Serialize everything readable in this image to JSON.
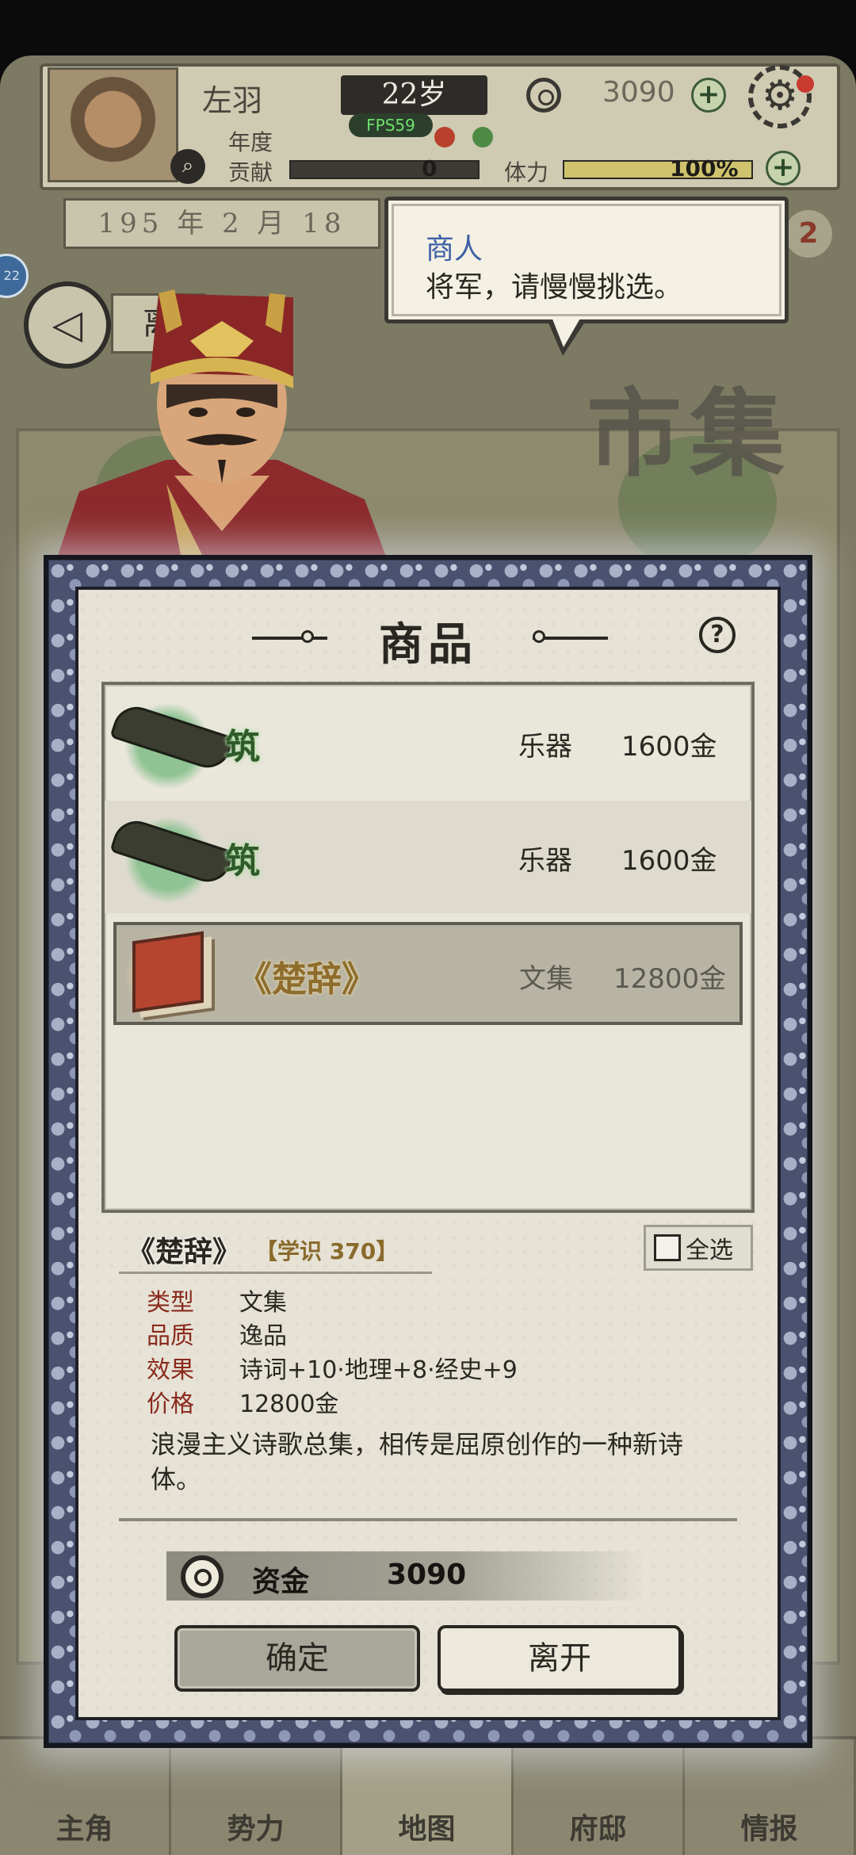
{
  "hud": {
    "name": "左羽",
    "age": "22岁",
    "fps": "FPS59",
    "money": "3090",
    "label_year": "年度",
    "label_contrib": "贡献",
    "contrib_value": "0",
    "label_stamina": "体力",
    "stamina_value": "100%",
    "stamina_fraction": 1.0,
    "date": "195 年 2 月 18",
    "back_label": "离",
    "left_bubble": "22",
    "right_badge": "2"
  },
  "scene": {
    "sign_text": "市集"
  },
  "speech": {
    "speaker": "商人",
    "text": "将军，请慢慢挑选。"
  },
  "dialog": {
    "title": "商品",
    "help": "?",
    "goods": [
      {
        "name": "筑",
        "category": "乐器",
        "price": "1600金",
        "icon": "zither-icon",
        "quality": "green"
      },
      {
        "name": "筑",
        "category": "乐器",
        "price": "1600金",
        "icon": "zither-icon",
        "quality": "green"
      },
      {
        "name": "《楚辞》",
        "category": "文集",
        "price": "12800金",
        "icon": "book-icon",
        "quality": "gold",
        "selected": true
      }
    ],
    "detail": {
      "title": "《楚辞》",
      "tag": "【学识 370】",
      "select_all": "全选",
      "attrs": [
        {
          "key": "类型",
          "value": "文集"
        },
        {
          "key": "品质",
          "value": "逸品"
        },
        {
          "key": "效果",
          "value": "诗词+10·地理+8·经史+9"
        },
        {
          "key": "价格",
          "value": "12800金"
        }
      ],
      "description": "浪漫主义诗歌总集，相传是屈原创作的一种新诗体。"
    },
    "funds_label": "资金",
    "funds_value": "3090",
    "confirm": "确定",
    "leave": "离开"
  },
  "nav": {
    "items": [
      "主角",
      "势力",
      "地图",
      "府邸",
      "情报"
    ],
    "active": 2
  },
  "colors": {
    "paper": "#e6e2d6",
    "frame": "#4a5270",
    "green_quality": "#2f5a2a",
    "gold_quality": "#8e6d2c",
    "attr_key": "#8b2a1d",
    "speaker": "#3c5fa6",
    "fps": "#6ee06a"
  }
}
